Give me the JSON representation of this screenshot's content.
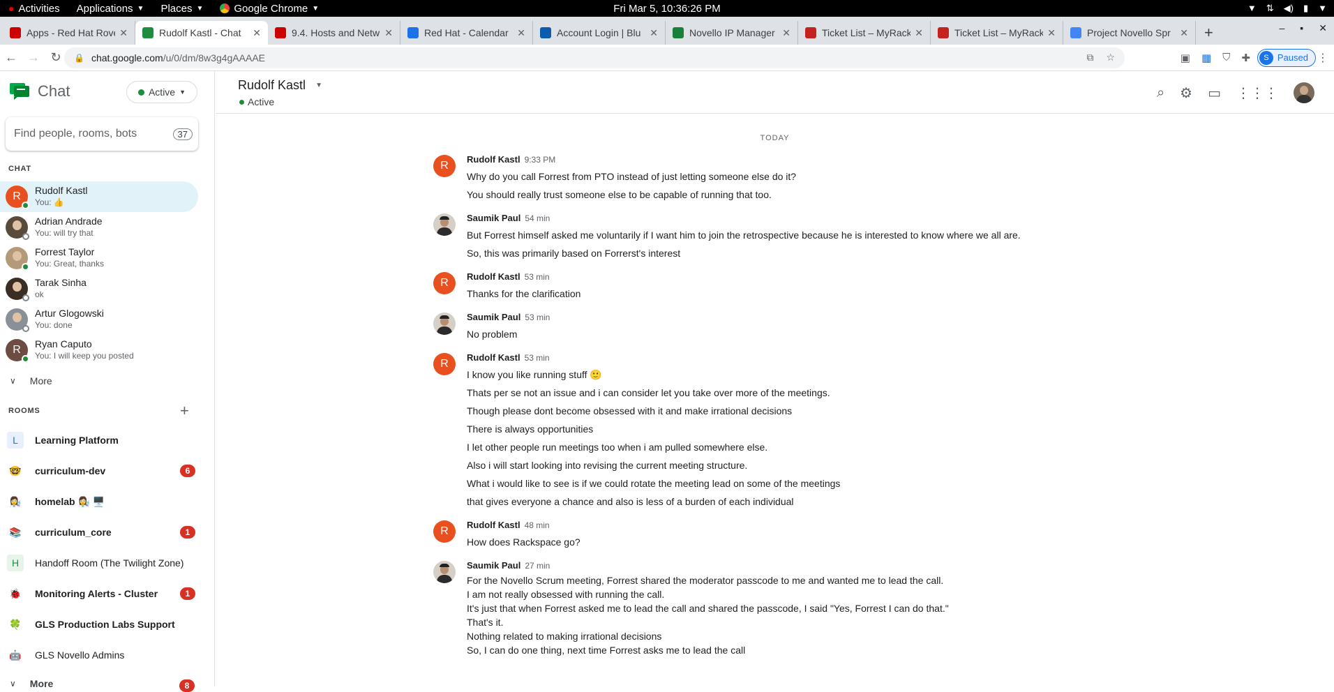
{
  "system_bar": {
    "activities": "Activities",
    "applications": "Applications",
    "places": "Places",
    "app_name": "Google Chrome",
    "clock": "Fri Mar  5, 10:36:26 PM"
  },
  "tabs": [
    {
      "title": "Apps - Red Hat Rove",
      "color": "#cc0000"
    },
    {
      "title": "Rudolf Kastl - Chat",
      "color": "#1e8e3e"
    },
    {
      "title": "9.4. Hosts and Netw",
      "color": "#cc0000"
    },
    {
      "title": "Red Hat - Calendar",
      "color": "#1a73e8"
    },
    {
      "title": "Account Login | Blu",
      "color": "#0b5cad"
    },
    {
      "title": "Novello IP Manager",
      "color": "#188038"
    },
    {
      "title": "Ticket List – MyRack",
      "color": "#c5221f"
    },
    {
      "title": "Ticket List – MyRack",
      "color": "#c5221f"
    },
    {
      "title": "Project Novello Spr",
      "color": "#4285f4"
    }
  ],
  "address_bar": {
    "url_domain": "chat.google.com",
    "url_path": "/u/0/dm/8w3g4gAAAAE",
    "profile_label": "Paused",
    "profile_initial": "S"
  },
  "sidebar": {
    "brand": "Chat",
    "status": "Active",
    "search_placeholder": "Find people, rooms, bots",
    "search_count": "37",
    "chat_label": "CHAT",
    "dms": [
      {
        "name": "Rudolf Kastl",
        "sub": "You: 👍",
        "initial": "R",
        "color": "#e8501f",
        "online": true
      },
      {
        "name": "Adrian Andrade",
        "sub": "You: will try that",
        "initial": "",
        "color": "#5a4a3a",
        "online": false
      },
      {
        "name": "Forrest Taylor",
        "sub": "You: Great, thanks",
        "initial": "",
        "color": "#b59a7a",
        "online": true
      },
      {
        "name": "Tarak Sinha",
        "sub": "ok",
        "initial": "",
        "color": "#3a2e24",
        "online": false
      },
      {
        "name": "Artur Glogowski",
        "sub": "You: done",
        "initial": "",
        "color": "#8a9098",
        "online": false
      },
      {
        "name": "Ryan Caputo",
        "sub": "You: I will keep you posted",
        "initial": "R",
        "color": "#6d4c41",
        "online": true
      }
    ],
    "more_label": "More",
    "rooms_label": "ROOMS",
    "rooms": [
      {
        "name": "Learning Platform",
        "icon": "L",
        "icon_bg": "#e8f0fe",
        "icon_fg": "#1a73e8",
        "bold": true,
        "badge": ""
      },
      {
        "name": "curriculum-dev",
        "icon": "🤓",
        "icon_bg": "transparent",
        "icon_fg": "#000",
        "bold": true,
        "badge": "6"
      },
      {
        "name": "homelab 👩‍🔬 🖥️",
        "icon": "👩‍🔬",
        "icon_bg": "transparent",
        "icon_fg": "#000",
        "bold": true,
        "badge": ""
      },
      {
        "name": "curriculum_core",
        "icon": "📚",
        "icon_bg": "transparent",
        "icon_fg": "#000",
        "bold": true,
        "badge": "1"
      },
      {
        "name": "Handoff Room (The Twilight Zone)",
        "icon": "H",
        "icon_bg": "#e6f4ea",
        "icon_fg": "#1e8e3e",
        "bold": false,
        "badge": ""
      },
      {
        "name": "Monitoring Alerts - Cluster",
        "icon": "🐞",
        "icon_bg": "transparent",
        "icon_fg": "#000",
        "bold": true,
        "badge": "1"
      },
      {
        "name": "GLS Production Labs Support",
        "icon": "🍀",
        "icon_bg": "transparent",
        "icon_fg": "#000",
        "bold": true,
        "badge": ""
      },
      {
        "name": "GLS Novello Admins",
        "icon": "🤖",
        "icon_bg": "transparent",
        "icon_fg": "#000",
        "bold": false,
        "badge": ""
      }
    ],
    "rooms_more_label": "More",
    "rooms_more_badge": "8"
  },
  "conversation": {
    "title": "Rudolf Kastl",
    "status": "Active",
    "day_label": "TODAY",
    "messages": [
      {
        "author": "Rudolf Kastl",
        "time": "9:33 PM",
        "avatar": "R",
        "lines": [
          "Why do you call Forrest from PTO instead of just letting someone else do it?",
          "You should really trust someone else to be capable of running that too."
        ],
        "tight": false
      },
      {
        "author": "Saumik Paul",
        "time": "54 min",
        "avatar": "",
        "lines": [
          "But Forrest himself asked me voluntarily if I want him to join the retrospective because he is interested to know where we all are.",
          "So, this was primarily based on Forrerst's interest"
        ],
        "tight": false
      },
      {
        "author": "Rudolf Kastl",
        "time": "53 min",
        "avatar": "R",
        "lines": [
          "Thanks for the clarification"
        ],
        "tight": false
      },
      {
        "author": "Saumik Paul",
        "time": "53 min",
        "avatar": "",
        "lines": [
          "No problem"
        ],
        "tight": false
      },
      {
        "author": "Rudolf Kastl",
        "time": "53 min",
        "avatar": "R",
        "lines": [
          "I know you like running stuff 🙂",
          "Thats per se not an issue and i can consider let you take over more of the meetings.",
          "Though please dont become obsessed with it and make irrational decisions",
          "There is always opportunities",
          "I let other people run meetings too when i am pulled somewhere else.",
          "Also i will start looking into revising the current meeting structure.",
          "What i would like to see is if we could rotate the meeting lead on some of the meetings",
          "that gives everyone a chance and also is less of a burden of each individual"
        ],
        "tight": false
      },
      {
        "author": "Rudolf Kastl",
        "time": "48 min",
        "avatar": "R",
        "lines": [
          "How does Rackspace go?"
        ],
        "tight": false
      },
      {
        "author": "Saumik Paul",
        "time": "27 min",
        "avatar": "",
        "lines": [
          "For the Novello Scrum meeting, Forrest shared the moderator passcode to me and wanted me to lead the call.",
          "I am not really obsessed with running the call.",
          "It's just that when Forrest asked me to lead the call and shared the passcode, I said \"Yes, Forrest I can do that.\"",
          "That's it.",
          "Nothing related to making irrational decisions",
          "So, I can do one thing, next time Forrest asks me to lead the call"
        ],
        "tight": true
      }
    ]
  }
}
